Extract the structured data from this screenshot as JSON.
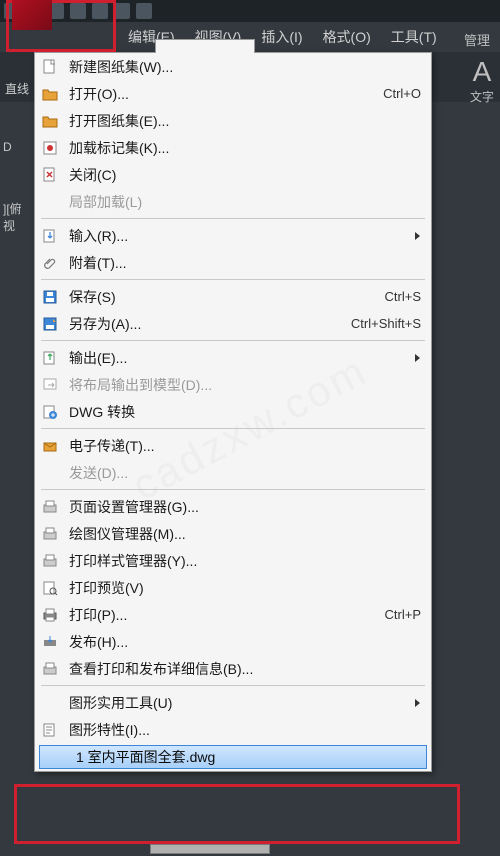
{
  "menubar": {
    "items": [
      "编辑(E)",
      "视图(V)",
      "插入(I)",
      "格式(O)",
      "工具(T)"
    ]
  },
  "ribbon": {
    "left_label": "直线",
    "right_letter": "A",
    "right_label": "文字",
    "tab_label": "管理"
  },
  "dark_left": {
    "d": "D",
    "view": "][俯视"
  },
  "file_menu": {
    "items": [
      {
        "label": "新建图纸集(W)...",
        "icon": "new-sheet"
      },
      {
        "label": "打开(O)...",
        "icon": "open",
        "shortcut": "Ctrl+O"
      },
      {
        "label": "打开图纸集(E)...",
        "icon": "open-sheet"
      },
      {
        "label": "加载标记集(K)...",
        "icon": "load-markup"
      },
      {
        "label": "关闭(C)",
        "icon": "close"
      },
      {
        "label": "局部加载(L)",
        "icon": "",
        "disabled": true
      },
      {
        "sep": true
      },
      {
        "label": "输入(R)...",
        "icon": "import",
        "submenu": true
      },
      {
        "label": "附着(T)...",
        "icon": "attach"
      },
      {
        "sep": true
      },
      {
        "label": "保存(S)",
        "icon": "save",
        "shortcut": "Ctrl+S"
      },
      {
        "label": "另存为(A)...",
        "icon": "save-as",
        "shortcut": "Ctrl+Shift+S"
      },
      {
        "sep": true
      },
      {
        "label": "输出(E)...",
        "icon": "export",
        "submenu": true
      },
      {
        "label": "将布局输出到模型(D)...",
        "icon": "layout-export",
        "disabled": true
      },
      {
        "label": "DWG 转换",
        "icon": "dwg-convert"
      },
      {
        "sep": true
      },
      {
        "label": "电子传递(T)...",
        "icon": "etransmit"
      },
      {
        "label": "发送(D)...",
        "icon": "",
        "disabled": true
      },
      {
        "sep": true
      },
      {
        "label": "页面设置管理器(G)...",
        "icon": "page-setup"
      },
      {
        "label": "绘图仪管理器(M)...",
        "icon": "plotter-mgr"
      },
      {
        "label": "打印样式管理器(Y)...",
        "icon": "plot-style"
      },
      {
        "label": "打印预览(V)",
        "icon": "print-preview"
      },
      {
        "label": "打印(P)...",
        "icon": "print",
        "shortcut": "Ctrl+P"
      },
      {
        "label": "发布(H)...",
        "icon": "publish"
      },
      {
        "label": "查看打印和发布详细信息(B)...",
        "icon": "plot-details"
      },
      {
        "sep": true
      },
      {
        "label": "图形实用工具(U)",
        "icon": "",
        "submenu": true
      },
      {
        "label": "图形特性(I)...",
        "icon": "drawing-props"
      }
    ],
    "recent": "1 室内平面图全套.dwg"
  },
  "watermark": "cadzxw.com"
}
